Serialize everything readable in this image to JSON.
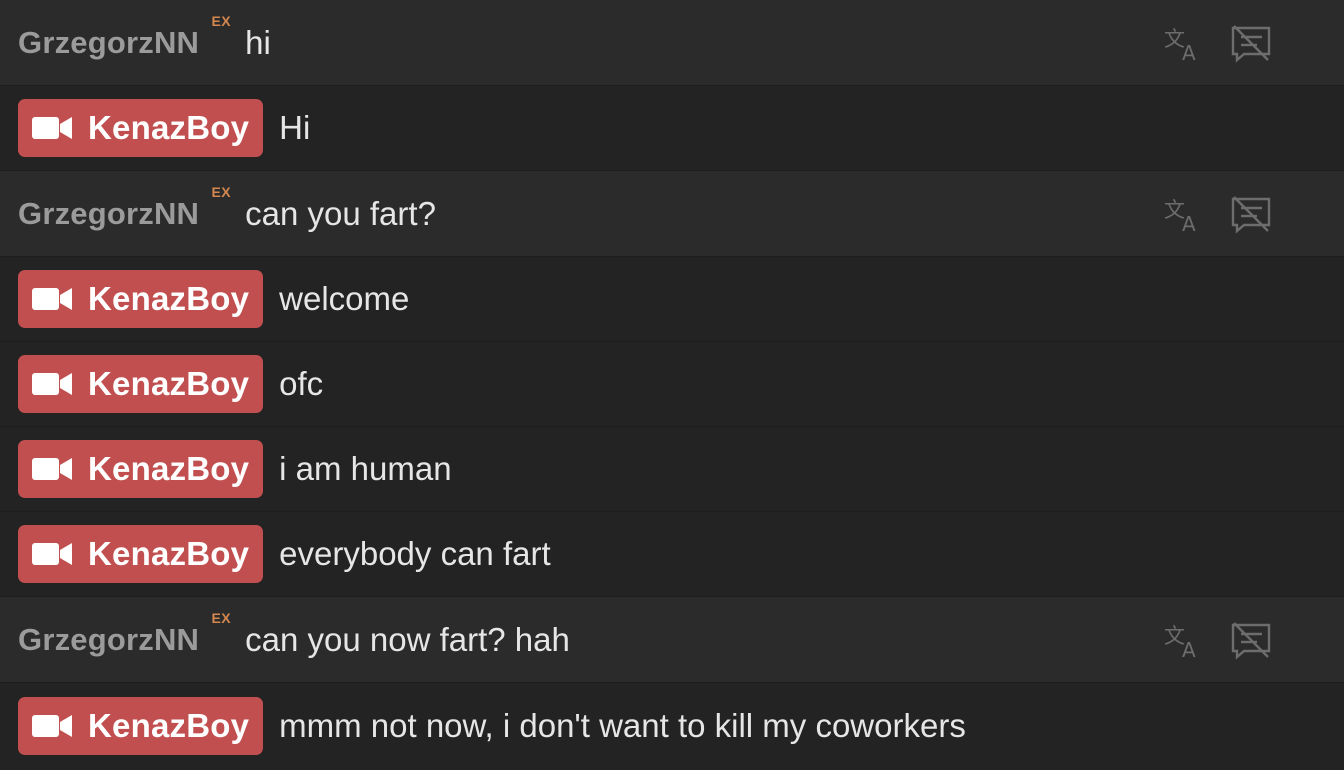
{
  "messages": [
    {
      "type": "viewer",
      "user": "GrzegorzNN",
      "badge": "EX",
      "text": "hi"
    },
    {
      "type": "host",
      "user": "KenazBoy",
      "text": "Hi"
    },
    {
      "type": "viewer",
      "user": "GrzegorzNN",
      "badge": "EX",
      "text": "can you fart?"
    },
    {
      "type": "host",
      "user": "KenazBoy",
      "text": "welcome"
    },
    {
      "type": "host",
      "user": "KenazBoy",
      "text": "ofc"
    },
    {
      "type": "host",
      "user": "KenazBoy",
      "text": "i am human"
    },
    {
      "type": "host",
      "user": "KenazBoy",
      "text": "everybody can fart"
    },
    {
      "type": "viewer",
      "user": "GrzegorzNN",
      "badge": "EX",
      "text": "can you now fart? hah"
    },
    {
      "type": "host",
      "user": "KenazBoy",
      "text": "mmm not now, i don't want to kill my coworkers"
    }
  ],
  "icons": {
    "host_badge": "video-camera-icon",
    "translate": "translate-icon",
    "hide": "hide-message-icon"
  },
  "colors": {
    "background": "#222222",
    "viewer_row": "#2b2b2b",
    "host_badge": "#c24f4f",
    "ex_badge": "#d4874e",
    "viewer_name": "#9b9b9b",
    "message_text": "#e6e6e6"
  }
}
